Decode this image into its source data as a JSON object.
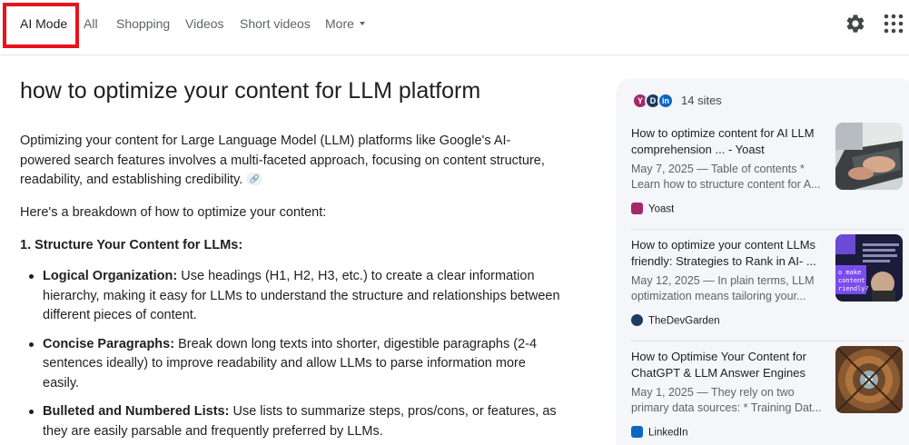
{
  "tabs": [
    {
      "label": "AI Mode",
      "active": true
    },
    {
      "label": "All"
    },
    {
      "label": "Shopping"
    },
    {
      "label": "Videos"
    },
    {
      "label": "Short videos"
    },
    {
      "label": "More"
    }
  ],
  "header_icons": [
    "gear-icon",
    "apps-grid-icon"
  ],
  "query_title": "how to optimize your content for LLM platform",
  "intro": "Optimizing your content for Large Language Model (LLM) platforms like Google's AI-powered search features involves a multi-faceted approach, focusing on content structure, readability, and establishing credibility.",
  "breakdown": "Here's a breakdown of how to optimize your content:",
  "section_heading": "1. Structure Your Content for LLMs:",
  "bullets": [
    {
      "term": "Logical Organization:",
      "text": " Use headings (H1, H2, H3, etc.) to create a clear information hierarchy, making it easy for LLMs to understand the structure and relationships between different pieces of content."
    },
    {
      "term": "Concise Paragraphs:",
      "text": " Break down long texts into shorter, digestible paragraphs (2-4 sentences ideally) to improve readability and allow LLMs to parse information more easily."
    },
    {
      "term": "Bulleted and Numbered Lists:",
      "text": " Use lists to summarize steps, pros/cons, or features, as they are easily parsable and frequently preferred by LLMs."
    }
  ],
  "sources_panel": {
    "count_label": "14 sites",
    "cards": [
      {
        "title": "How to optimize content for AI LLM comprehension ... - Yoast",
        "date": "May 7, 2025 — Table of contents *",
        "snippet": "Learn how to structure content for A...",
        "source": "Yoast",
        "source_color": "#a4286a"
      },
      {
        "title": "How to optimize your content LLMs friendly: Strategies to Rank in AI- ...",
        "date": "May 12, 2025 — In plain terms, LLM",
        "snippet": "optimization means tailoring your...",
        "source": "TheDevGarden",
        "source_color": "#1f3a5f"
      },
      {
        "title": "How to Optimise Your Content for ChatGPT & LLM Answer Engines",
        "date": "May 1, 2025 — They rely on two",
        "snippet": "primary data sources: * Training Dat...",
        "source": "LinkedIn",
        "source_color": "#0a66c2"
      }
    ]
  },
  "colors": {
    "highlight": "#e8131b",
    "panel_bg": "#f4f6f9"
  }
}
